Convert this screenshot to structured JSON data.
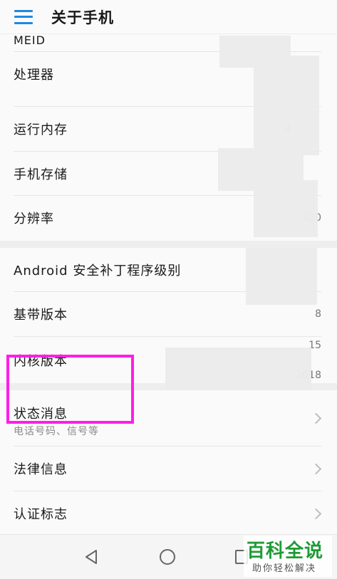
{
  "appbar": {
    "title": "关于手机"
  },
  "rows": [
    {
      "label": "MEID",
      "value": ""
    },
    {
      "label": "处理器",
      "value": ""
    },
    {
      "label": "运行内存",
      "value": "4"
    },
    {
      "label": "手机存储",
      "value": ""
    },
    {
      "label": "分辨率",
      "value": "920"
    },
    {
      "label": "Android 安全补丁程序级别",
      "value": ""
    },
    {
      "label": "基带版本",
      "value": "8"
    },
    {
      "label": "内核版本",
      "value": "15",
      "value2": "2018"
    }
  ],
  "status": {
    "label": "状态消息",
    "sub": "电话号码、信号等"
  },
  "legal": {
    "label": "法律信息"
  },
  "cert": {
    "label": "认证标志"
  },
  "watermark": {
    "title": "百科全说",
    "sub": "助你轻松解决"
  },
  "colors": {
    "menu": "#1e88e5",
    "highlight": "#ff1ee6",
    "watermark": "#1f9b36"
  }
}
